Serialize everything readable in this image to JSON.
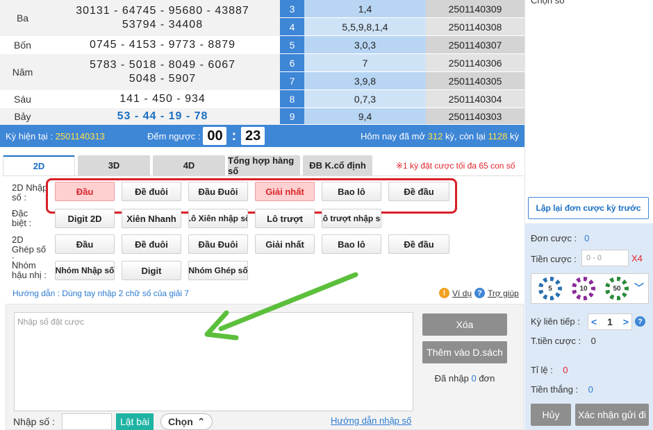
{
  "results": {
    "prizes": [
      {
        "name": "Ba",
        "lines": [
          "30131 - 64745 - 95680 - 43887",
          "53794 - 34408"
        ]
      },
      {
        "name": "Bốn",
        "lines": [
          "0745 - 4153 - 9773 - 8879"
        ]
      },
      {
        "name": "Năm",
        "lines": [
          "5783 - 5018 - 8049 - 6067",
          "5048 - 5907"
        ]
      },
      {
        "name": "Sáu",
        "lines": [
          "141 - 450 - 934"
        ]
      },
      {
        "name": "Bảy",
        "lines": [
          "53 - 44 - 19 - 78"
        ]
      }
    ],
    "history": [
      {
        "idx": "3",
        "result": "1,4",
        "ky": "2501140309"
      },
      {
        "idx": "4",
        "result": "5,5,9,8,1,4",
        "ky": "2501140308"
      },
      {
        "idx": "5",
        "result": "3,0,3",
        "ky": "2501140307"
      },
      {
        "idx": "6",
        "result": "7",
        "ky": "2501140306"
      },
      {
        "idx": "7",
        "result": "3,9,8",
        "ky": "2501140305"
      },
      {
        "idx": "8",
        "result": "0,7,3",
        "ky": "2501140304"
      },
      {
        "idx": "9",
        "result": "9,4",
        "ky": "2501140303"
      }
    ]
  },
  "status": {
    "current_label": "Kỳ hiện tại  :",
    "current_value": "2501140313",
    "countdown_label": "Đếm ngược :",
    "minutes": "00",
    "colon": ":",
    "seconds": "23",
    "today_prefix": "Hôm nay đã mở",
    "opened": "312",
    "mid": "kỳ, còn lại",
    "remaining": "1128",
    "suffix": "kỳ"
  },
  "tabs": [
    "2D",
    "3D",
    "4D",
    "Tổng hợp hàng số",
    "ĐB K.cố định"
  ],
  "tab_note": "※1 kỳ đặt cược tối đa 65 con số",
  "rows": {
    "nhap_label": "2D Nhập số :",
    "nhap": [
      "Đầu",
      "Đề đuôi",
      "Đầu Đuôi",
      "Giải nhất",
      "Bao lô",
      "Đề đầu"
    ],
    "dacbiet_label": "Đặc biệt :",
    "dacbiet": [
      "Digit 2D",
      "Xiên Nhanh",
      "Lô Xiên nhập số",
      "Lô trượt",
      "Lô trượt nhập số"
    ],
    "ghep_label": "2D Ghép số :",
    "ghep": [
      "Đầu",
      "Đề đuôi",
      "Đầu Đuôi",
      "Giải nhất",
      "Bao lô",
      "Đề đầu"
    ],
    "nhom_label": "Nhóm hậu nhị :",
    "nhom": [
      "Nhóm Nhập số",
      "Digit",
      "Nhóm Ghép số"
    ]
  },
  "guide": "Hướng dẫn : Dùng tay nhập 2 chữ số của giải 7",
  "help": {
    "example_icon": "!",
    "example": "Ví dụ",
    "help_icon": "?",
    "help": "Trợ giúp"
  },
  "input": {
    "placeholder": "Nhập số đặt cược",
    "delete": "Xóa",
    "add": "Thêm vào D.sách",
    "entered_prefix": "Đã nhập",
    "entered_count": "0",
    "entered_suffix": "đơn",
    "nhap_so_label": "Nhập số :",
    "lat_bai": "Lật bài",
    "chon": "Chọn",
    "chon_caret": "⌃",
    "guide_link": "Hướng dẫn nhập số"
  },
  "right": {
    "top_label": "Chọn số",
    "reload": "Lập lại đơn cược kỳ trước",
    "don_cuoc_label": "Đơn cược :",
    "don_cuoc": "0",
    "tien_cuoc_label": "Tiền cược :",
    "tien_placeholder": "0 - 0",
    "multiplier": "X4",
    "chips": [
      {
        "value": "5",
        "color": "#2b6fb0"
      },
      {
        "value": "10",
        "color": "#8a2a98"
      },
      {
        "value": "50",
        "color": "#2a8a3a"
      }
    ],
    "chip_caret": "﹀",
    "ky_lien_tiep_label": "Kỳ liên tiếp :",
    "ky_lien_tiep": "1",
    "prev": "<",
    "next": ">",
    "ky_help": "?",
    "t_tien_label": "T.tiền cược :",
    "t_tien": "0",
    "ti_le_label": "Tỉ lệ :",
    "ti_le": "0",
    "tien_thang_label": "Tiền thắng :",
    "tien_thang": "0",
    "cancel": "Hủy",
    "confirm": "Xác nhận gửi đi"
  },
  "colors": {
    "primary": "#3e86d6",
    "highlight": "#ffe14a",
    "alert": "#e0232b",
    "selected": "#ffd0d0",
    "accent_green": "#1fb3a3",
    "arrow": "#5cbf3c"
  }
}
